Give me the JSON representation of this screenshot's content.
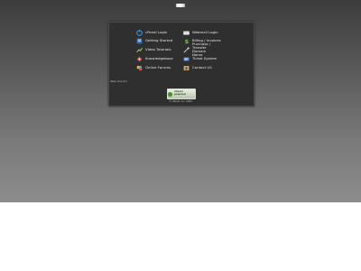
{
  "links": {
    "cpanel_login": "cPanel Login",
    "webmail_login": "Webmail Login",
    "getting_started": "Getting Started",
    "billing_invoices": "Billing / Invoices",
    "video_tutorials": "Video Tutorials",
    "purchase_transfer": "Purchase / Transfer Domain Name",
    "knowledgebase": "Knowledgebase",
    "ticket_system": "Ticket System",
    "online_forums": "Online Forums",
    "contact_us": "Contact US"
  },
  "footer_note": "Web director",
  "powered_badge": "cPanel powered",
  "copyright": "© cPanel, Inc. 2009"
}
